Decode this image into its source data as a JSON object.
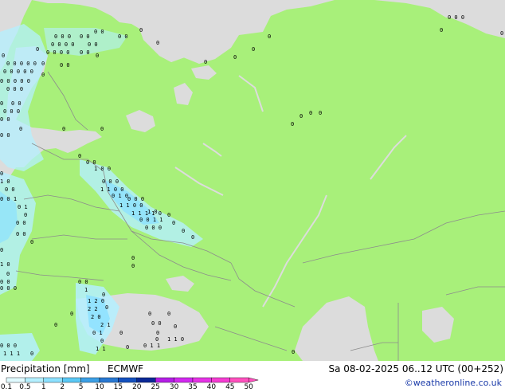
{
  "legend": {
    "title": "Precipitation [mm]",
    "model": "ECMWF",
    "ticks": [
      "0.1",
      "0.5",
      "1",
      "2",
      "5",
      "10",
      "15",
      "20",
      "25",
      "30",
      "35",
      "40",
      "45",
      "50"
    ],
    "colors": [
      "#e0fbff",
      "#b4f0ff",
      "#8ce1ff",
      "#5ac8f5",
      "#3ca0e6",
      "#2878d2",
      "#1450be",
      "#0a2896",
      "#b41ee6",
      "#d228f0",
      "#e632e6",
      "#f53cd2",
      "#ff50be"
    ]
  },
  "valid_time": "Sa 08-02-2025 06..12 UTC (00+252)",
  "credit": "©weatheronline.co.uk",
  "map_colors": {
    "land": "#a8f07a",
    "sea": "#dcdcdc",
    "light_precip": "#b4f0ff",
    "medium_precip": "#8ce1ff"
  }
}
